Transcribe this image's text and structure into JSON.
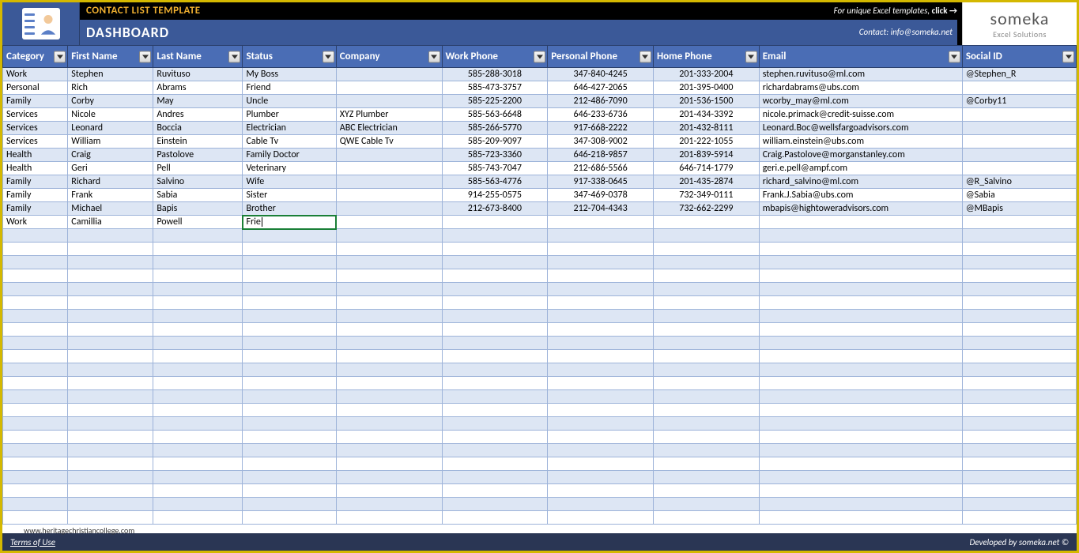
{
  "header": {
    "title_top": "CONTACT LIST TEMPLATE",
    "title_bottom": "DASHBOARD",
    "promo_text": "For unique Excel templates, ",
    "promo_click": "click →",
    "contact_label": "Contact: info@someka.net",
    "brand_name": "someka",
    "brand_sub": "Excel Solutions"
  },
  "columns": [
    "Category",
    "First Name",
    "Last Name",
    "Status",
    "Company",
    "Work Phone",
    "Personal Phone",
    "Home Phone",
    "Email",
    "Social ID"
  ],
  "rows": [
    {
      "category": "Work",
      "first": "Stephen",
      "last": "Ruvituso",
      "status": "My Boss",
      "company": "",
      "work": "585-288-3018",
      "personal": "347-840-4245",
      "home": "201-333-2004",
      "email": "stephen.ruvituso@ml.com",
      "social": "@Stephen_R"
    },
    {
      "category": "Personal",
      "first": "Rich",
      "last": "Abrams",
      "status": "Friend",
      "company": "",
      "work": "585-473-3757",
      "personal": "646-427-2065",
      "home": "201-395-0400",
      "email": "richardabrams@ubs.com",
      "social": ""
    },
    {
      "category": "Family",
      "first": "Corby",
      "last": "May",
      "status": "Uncle",
      "company": "",
      "work": "585-225-2200",
      "personal": "212-486-7090",
      "home": "201-536-1500",
      "email": "wcorby_may@ml.com",
      "social": "@Corby11"
    },
    {
      "category": "Services",
      "first": "Nicole",
      "last": "Andres",
      "status": "Plumber",
      "company": "XYZ Plumber",
      "work": "585-563-6648",
      "personal": "646-233-6736",
      "home": "201-434-3392",
      "email": "nicole.primack@credit-suisse.com",
      "social": ""
    },
    {
      "category": "Services",
      "first": "Leonard",
      "last": "Boccia",
      "status": "Electrician",
      "company": "ABC Electrician",
      "work": "585-266-5770",
      "personal": "917-668-2222",
      "home": "201-432-8111",
      "email": "Leonard.Boc@wellsfargoadvisors.com",
      "social": ""
    },
    {
      "category": "Services",
      "first": "William",
      "last": "Einstein",
      "status": "Cable Tv",
      "company": "QWE Cable Tv",
      "work": "585-209-9097",
      "personal": "347-308-9002",
      "home": "201-222-1055",
      "email": "william.einstein@ubs.com",
      "social": ""
    },
    {
      "category": "Health",
      "first": "Craig",
      "last": "Pastolove",
      "status": "Family Doctor",
      "company": "",
      "work": "585-723-3360",
      "personal": "646-218-9857",
      "home": "201-839-5914",
      "email": "Craig.Pastolove@morganstanley.com",
      "social": ""
    },
    {
      "category": "Health",
      "first": "Geri",
      "last": "Pell",
      "status": "Veterinary",
      "company": "",
      "work": "585-743-7047",
      "personal": "212-686-5566",
      "home": "646-714-1779",
      "email": "geri.e.pell@ampf.com",
      "social": ""
    },
    {
      "category": "Family",
      "first": "Richard",
      "last": "Salvino",
      "status": "Wife",
      "company": "",
      "work": "585-563-4776",
      "personal": "917-338-0645",
      "home": "201-435-2874",
      "email": "richard_salvino@ml.com",
      "social": "@R_Salvino"
    },
    {
      "category": "Family",
      "first": "Frank",
      "last": "Sabia",
      "status": "Sister",
      "company": "",
      "work": "914-255-0575",
      "personal": "347-469-0378",
      "home": "732-349-0111",
      "email": "Frank.J.Sabia@ubs.com",
      "social": "@Sabia"
    },
    {
      "category": "Family",
      "first": "Michael",
      "last": "Bapis",
      "status": "Brother",
      "company": "",
      "work": "212-673-8400",
      "personal": "212-704-4343",
      "home": "732-662-2299",
      "email": "mbapis@hightoweradvisors.com",
      "social": "@MBapis"
    },
    {
      "category": "Work",
      "first": "Camillia",
      "last": "Powell",
      "status": "Frie",
      "company": "",
      "work": "",
      "personal": "",
      "home": "",
      "email": "",
      "social": ""
    }
  ],
  "editing": {
    "row_index": 11,
    "col_key": "status",
    "value": "Frie"
  },
  "empty_rows": 22,
  "footer": {
    "terms": "Terms of Use",
    "credit": "Developed by someka.net ©"
  },
  "watermark": "www.heritagechristiancollege.com"
}
